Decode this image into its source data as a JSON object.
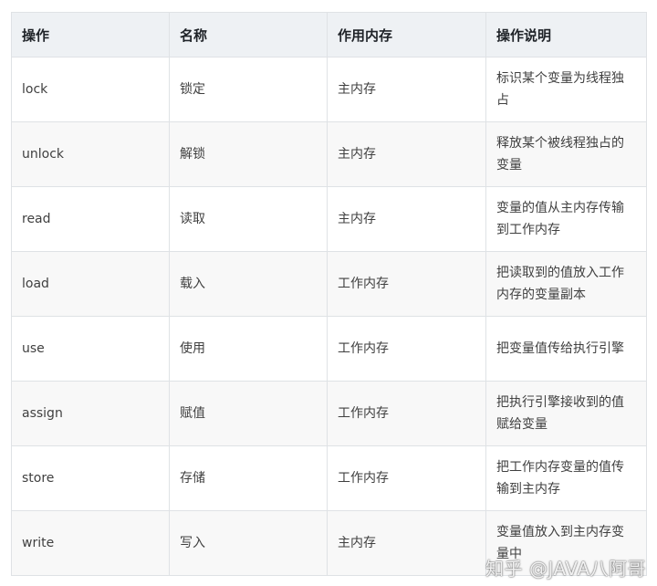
{
  "table": {
    "headers": [
      "操作",
      "名称",
      "作用内存",
      "操作说明"
    ],
    "rows": [
      {
        "op": "lock",
        "name": "锁定",
        "memory": "主内存",
        "desc": "标识某个变量为线程独占"
      },
      {
        "op": "unlock",
        "name": "解锁",
        "memory": "主内存",
        "desc": "释放某个被线程独占的变量"
      },
      {
        "op": "read",
        "name": "读取",
        "memory": "主内存",
        "desc": "变量的值从主内存传输到工作内存"
      },
      {
        "op": "load",
        "name": "载入",
        "memory": "工作内存",
        "desc": "把读取到的值放入工作内存的变量副本"
      },
      {
        "op": "use",
        "name": "使用",
        "memory": "工作内存",
        "desc": "把变量值传给执行引擎"
      },
      {
        "op": "assign",
        "name": "赋值",
        "memory": "工作内存",
        "desc": "把执行引擎接收到的值赋给变量"
      },
      {
        "op": "store",
        "name": "存储",
        "memory": "工作内存",
        "desc": "把工作内存变量的值传输到主内存"
      },
      {
        "op": "write",
        "name": "写入",
        "memory": "主内存",
        "desc": "变量值放入到主内存变量中"
      }
    ]
  },
  "watermark": "知乎 @JAVA八阿哥"
}
